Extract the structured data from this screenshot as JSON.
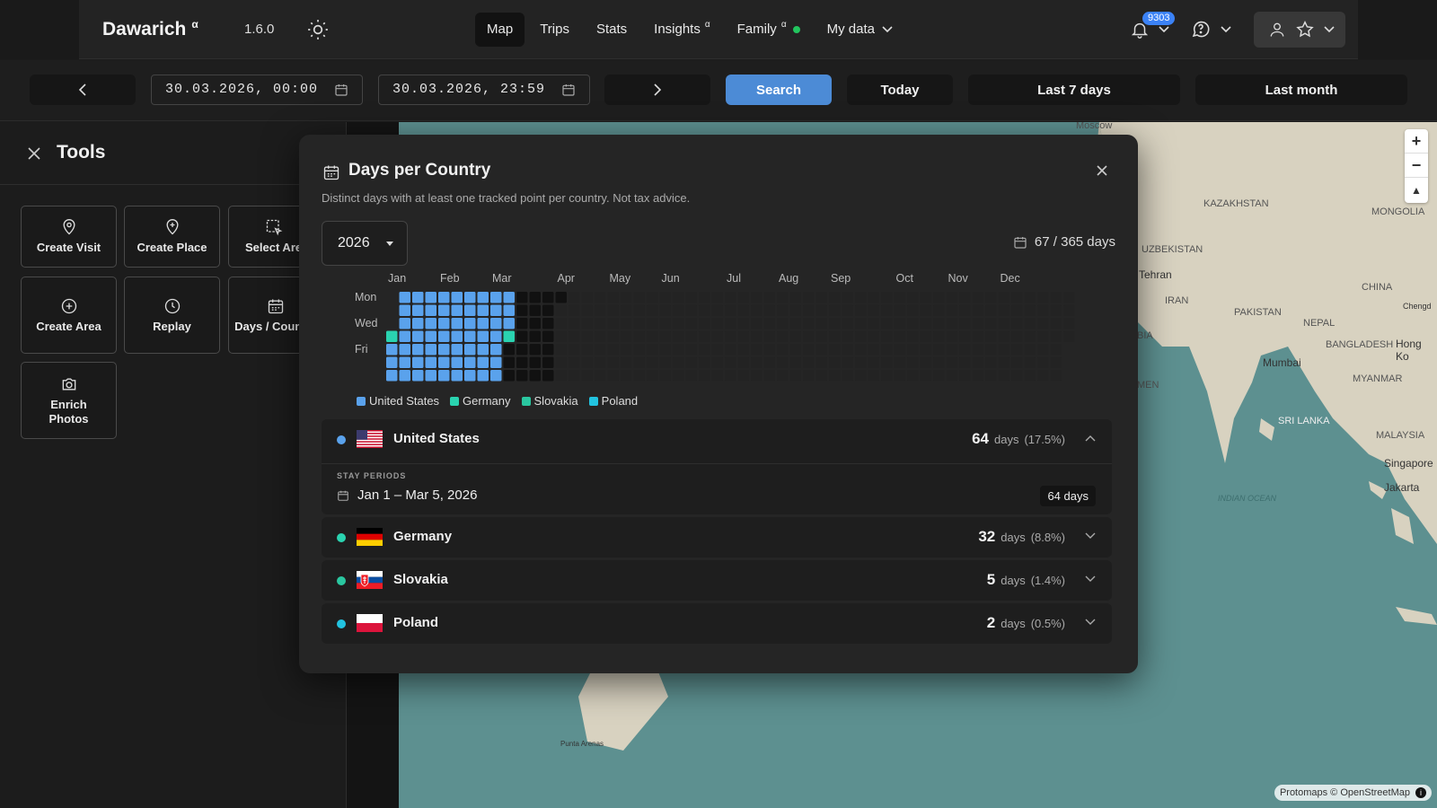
{
  "app": {
    "name": "Dawarich",
    "name_sup": "α",
    "version": "1.6.0"
  },
  "nav": {
    "items": [
      {
        "label": "Map",
        "active": true
      },
      {
        "label": "Trips"
      },
      {
        "label": "Stats"
      },
      {
        "label": "Insights",
        "sup": "α"
      },
      {
        "label": "Family",
        "sup": "α",
        "status_dot": true
      },
      {
        "label": "My data",
        "dropdown": true
      }
    ],
    "notification_count": "9303"
  },
  "datebar": {
    "start": "30.03.2026, 00:00",
    "end": "30.03.2026, 23:59",
    "search_label": "Search",
    "today_label": "Today",
    "last7_label": "Last 7 days",
    "lastmonth_label": "Last month"
  },
  "tools": {
    "title": "Tools",
    "items": [
      {
        "label": "Create Visit",
        "icon": "map-pin-icon"
      },
      {
        "label": "Create Place",
        "icon": "map-pin-plus-icon"
      },
      {
        "label": "Select Are",
        "icon": "select-area-icon"
      },
      {
        "label": "Create Area",
        "icon": "circle-plus-icon"
      },
      {
        "label": "Replay",
        "icon": "clock-icon"
      },
      {
        "label": "Days / Country",
        "icon": "calendar-icon"
      },
      {
        "label": "Enrich Photos",
        "icon": "camera-icon"
      }
    ]
  },
  "modal": {
    "title": "Days per Country",
    "subtitle": "Distinct days with at least one tracked point per country. Not tax advice.",
    "year": "2026",
    "days_summary": "67 / 365 days",
    "months": [
      "Jan",
      "Feb",
      "Mar",
      "Apr",
      "May",
      "Jun",
      "Jul",
      "Aug",
      "Sep",
      "Oct",
      "Nov",
      "Dec"
    ],
    "weekday_labels": [
      "Mon",
      "Wed",
      "Fri"
    ],
    "legend": [
      {
        "label": "United States",
        "color": "#5aa2ec"
      },
      {
        "label": "Germany",
        "color": "#2ad3b0"
      },
      {
        "label": "Slovakia",
        "color": "#2ac7a0"
      },
      {
        "label": "Poland",
        "color": "#22c3e0"
      }
    ],
    "countries": [
      {
        "name": "United States",
        "days": "64",
        "days_unit": "days",
        "pct": "(17.5%)",
        "dot": "#5aa2ec",
        "flag": "us",
        "expanded": true,
        "stay_label": "STAY PERIODS",
        "stay_range": "Jan 1 – Mar 5, 2026",
        "stay_days": "64  days"
      },
      {
        "name": "Germany",
        "days": "32",
        "days_unit": "days",
        "pct": "(8.8%)",
        "dot": "#2ad3b0",
        "flag": "de"
      },
      {
        "name": "Slovakia",
        "days": "5",
        "days_unit": "days",
        "pct": "(1.4%)",
        "dot": "#2ac7a0",
        "flag": "sk"
      },
      {
        "name": "Poland",
        "days": "2",
        "days_unit": "days",
        "pct": "(0.5%)",
        "dot": "#22c3e0",
        "flag": "pl"
      }
    ]
  },
  "map": {
    "labels": [
      "Moscow",
      "KAZAKHSTAN",
      "MONGOLIA",
      "UZBEKISTAN",
      "Tehran",
      "IRAN",
      "CHINA",
      "PAKISTAN",
      "NEPAL",
      "BANGLADESH",
      "Hong Ko",
      "Chengd",
      "Mumbai",
      "MYANMAR",
      "SRI LANKA",
      "MALAYSIA",
      "Singapore",
      "Jakarta",
      "INDIAN OCEAN",
      "Punta Arenas",
      "MEN",
      "BIA"
    ],
    "attribution": "Protomaps © OpenStreetMap"
  }
}
